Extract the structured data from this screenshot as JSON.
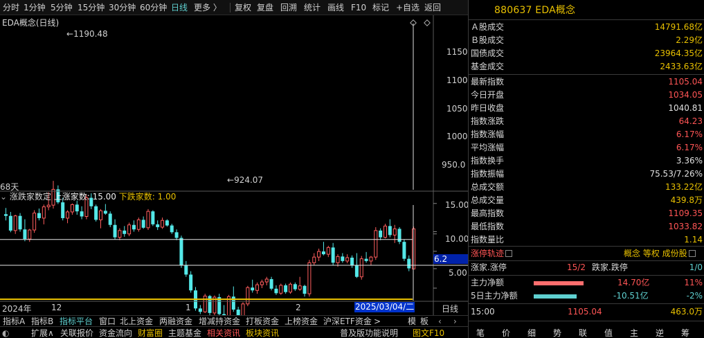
{
  "toolbar": {
    "items": [
      "分时",
      "1分钟",
      "5分钟",
      "15分钟",
      "30分钟",
      "60分钟",
      "日线",
      "更多 〉",
      "复权",
      "复盘",
      "回溯",
      "统计",
      "画线",
      "F10",
      "标记",
      "+自选",
      "返回"
    ],
    "active": "日线"
  },
  "chart": {
    "title": "EDA概念(日线)",
    "days_label": "68天",
    "high_marker": "1190.48",
    "low_marker": "924.07",
    "y_ticks": [
      "1150",
      "1100",
      "1050",
      "1000",
      "950.0"
    ],
    "indicator": {
      "name": "涨跌家数定",
      "up_label": "上涨家数: 15.00",
      "down_label": "下跌家数: 1.00",
      "y_ticks": [
        "15.00",
        "10.00",
        "5.00"
      ],
      "current_tag": "6.2"
    },
    "x_labels": [
      "2024年",
      "12",
      "1",
      "2"
    ],
    "cursor_date": "2025/03/04/二",
    "period_btn": "日线"
  },
  "chart_data": {
    "type": "candlestick",
    "ylim": [
      910,
      1200
    ],
    "candles": [
      [
        1131,
        1142,
        1120,
        1128
      ],
      [
        1128,
        1135,
        1099,
        1102
      ],
      [
        1102,
        1130,
        1096,
        1128
      ],
      [
        1128,
        1133,
        1100,
        1104
      ],
      [
        1104,
        1122,
        1083,
        1087
      ],
      [
        1087,
        1105,
        1082,
        1103
      ],
      [
        1103,
        1138,
        1098,
        1133
      ],
      [
        1133,
        1141,
        1120,
        1124
      ],
      [
        1124,
        1148,
        1113,
        1144
      ],
      [
        1144,
        1170,
        1138,
        1147
      ],
      [
        1147,
        1190,
        1141,
        1175
      ],
      [
        1175,
        1182,
        1149,
        1152
      ],
      [
        1152,
        1160,
        1120,
        1124
      ],
      [
        1124,
        1138,
        1115,
        1135
      ],
      [
        1135,
        1150,
        1130,
        1148
      ],
      [
        1148,
        1155,
        1130,
        1136
      ],
      [
        1136,
        1145,
        1122,
        1127
      ],
      [
        1127,
        1165,
        1122,
        1160
      ],
      [
        1160,
        1168,
        1140,
        1145
      ],
      [
        1145,
        1148,
        1118,
        1121
      ],
      [
        1121,
        1140,
        1106,
        1137
      ],
      [
        1137,
        1149,
        1130,
        1132
      ],
      [
        1132,
        1136,
        1108,
        1112
      ],
      [
        1112,
        1122,
        1086,
        1090
      ],
      [
        1090,
        1106,
        1085,
        1102
      ],
      [
        1102,
        1110,
        1091,
        1096
      ],
      [
        1096,
        1116,
        1092,
        1112
      ],
      [
        1112,
        1120,
        1100,
        1104
      ],
      [
        1104,
        1125,
        1100,
        1121
      ],
      [
        1121,
        1127,
        1105,
        1107
      ],
      [
        1107,
        1140,
        1103,
        1136
      ],
      [
        1136,
        1138,
        1110,
        1113
      ],
      [
        1113,
        1120,
        1103,
        1108
      ],
      [
        1108,
        1125,
        1105,
        1120
      ],
      [
        1120,
        1122,
        1109,
        1111
      ],
      [
        1111,
        1114,
        1096,
        1099
      ],
      [
        1099,
        1104,
        1085,
        1089
      ],
      [
        1089,
        1093,
        1036,
        1040
      ],
      [
        1040,
        1048,
        1020,
        1024
      ],
      [
        1024,
        1030,
        992,
        996
      ],
      [
        996,
        1002,
        960,
        964
      ],
      [
        964,
        970,
        954,
        958
      ],
      [
        958,
        990,
        956,
        986
      ],
      [
        986,
        988,
        952,
        956
      ],
      [
        956,
        987,
        952,
        984
      ],
      [
        984,
        990,
        948,
        954
      ],
      [
        954,
        970,
        935,
        944
      ],
      [
        944,
        988,
        940,
        985
      ],
      [
        985,
        1003,
        958,
        962
      ],
      [
        962,
        967,
        927,
        937
      ],
      [
        937,
        975,
        932,
        972
      ],
      [
        972,
        1004,
        968,
        1001
      ],
      [
        1001,
        1015,
        992,
        996
      ],
      [
        996,
        1010,
        990,
        1006
      ],
      [
        1006,
        1015,
        1000,
        1011
      ],
      [
        1011,
        1020,
        1005,
        1016
      ],
      [
        1016,
        1020,
        996,
        999
      ],
      [
        999,
        1005,
        988,
        991
      ],
      [
        991,
        1008,
        988,
        1005
      ],
      [
        1005,
        1008,
        990,
        993
      ],
      [
        993,
        1010,
        990,
        1007
      ],
      [
        1007,
        1010,
        995,
        998
      ],
      [
        998,
        1020,
        995,
        1004
      ],
      [
        1004,
        1006,
        985,
        990
      ],
      [
        990,
        1050,
        985,
        1045
      ],
      [
        1045,
        1062,
        1040,
        1055
      ],
      [
        1055,
        1070,
        1048,
        1065
      ],
      [
        1065,
        1082,
        1058,
        1060
      ],
      [
        1060,
        1075,
        1055,
        1072
      ],
      [
        1072,
        1080,
        1040,
        1045
      ],
      [
        1045,
        1060,
        1038,
        1056
      ],
      [
        1056,
        1062,
        1045,
        1048
      ],
      [
        1048,
        1060,
        1044,
        1054
      ],
      [
        1054,
        1058,
        1036,
        1040
      ],
      [
        1040,
        1062,
        1018,
        1020
      ],
      [
        1020,
        1057,
        1015,
        1052
      ],
      [
        1052,
        1064,
        1045,
        1048
      ],
      [
        1048,
        1057,
        1040,
        1055
      ],
      [
        1055,
        1108,
        1050,
        1102
      ],
      [
        1102,
        1106,
        1085,
        1090
      ],
      [
        1090,
        1114,
        1088,
        1110
      ],
      [
        1110,
        1122,
        1090,
        1094
      ],
      [
        1094,
        1112,
        1080,
        1105
      ],
      [
        1105,
        1108,
        1078,
        1082
      ],
      [
        1082,
        1086,
        1048,
        1052
      ],
      [
        1052,
        1058,
        1030,
        1035
      ],
      [
        1034,
        1109,
        1034,
        1105
      ]
    ],
    "indicator_series": {
      "name": "涨跌家数定",
      "up": 15.0,
      "down": 1.0,
      "ylim": [
        0,
        17.5
      ]
    }
  },
  "right_panel": {
    "title": "880637 EDA概念",
    "block1": [
      {
        "k": "Ａ股成交",
        "v": "14791.68亿"
      },
      {
        "k": "Ｂ股成交",
        "v": "2.29亿"
      },
      {
        "k": "国债成交",
        "v": "23964.35亿"
      },
      {
        "k": "基金成交",
        "v": "2433.63亿"
      }
    ],
    "block2": [
      {
        "k": "最新指数",
        "v": "1105.04",
        "c": "red"
      },
      {
        "k": "今日开盘",
        "v": "1034.05",
        "c": "red"
      },
      {
        "k": "昨日收盘",
        "v": "1040.81",
        "c": "white"
      },
      {
        "k": "指数涨跌",
        "v": "64.23",
        "c": "red"
      },
      {
        "k": "指数涨幅",
        "v": "6.17%",
        "c": "red"
      },
      {
        "k": "平均涨幅",
        "v": "6.17%",
        "c": "red"
      },
      {
        "k": "指数换手",
        "v": "3.36%",
        "c": "white"
      },
      {
        "k": "指数振幅",
        "v": "75.53/7.26%",
        "c": "white"
      },
      {
        "k": "总成交额",
        "v": "133.22亿",
        "c": "gold"
      },
      {
        "k": "总成交量",
        "v": "439.8万",
        "c": "gold"
      },
      {
        "k": "最高指数",
        "v": "1109.35",
        "c": "red"
      },
      {
        "k": "最低指数",
        "v": "1033.82",
        "c": "red"
      },
      {
        "k": "指数量比",
        "v": "1.14",
        "c": "gold"
      }
    ],
    "zt_label": "涨停轨迹",
    "zt_links": "概念 等权 成份股",
    "zt_row": {
      "k1": "涨家.涨停",
      "v1": "15/2",
      "k2": "跌家.跌停",
      "v2": "1/0"
    },
    "flow": [
      {
        "k": "主力净额",
        "v": "14.70亿",
        "p": "11%",
        "c": "red",
        "bar": 0.55
      },
      {
        "k": "5日主力净额",
        "v": "-10.51亿",
        "p": "-2%",
        "c": "cyan",
        "bar": 0.48
      }
    ],
    "last": {
      "time": "15:00",
      "price": "1105.04",
      "vol": "463.0万"
    },
    "bottom_btns": [
      "笔",
      "价",
      "细",
      "势",
      "联",
      "值",
      "主",
      "逆",
      "筹"
    ]
  },
  "tabs_row1": [
    "指标A",
    "指标B",
    "指标平台",
    "窗口",
    "北上资金",
    "两融资金",
    "增减持资金",
    "打板资金",
    "上榜资金",
    "沪深ETF资金",
    ">",
    "模",
    "板"
  ],
  "tabs_row1_active": "指标平台",
  "tabs_row2": [
    "扩展∧",
    "关联报价",
    "资金流向",
    "财富圈",
    "主题基金",
    "相关资讯",
    "板块资讯",
    "普及版功能说明",
    "图文F10"
  ],
  "colors": {
    "up": "#ff5e5e",
    "down": "#54e8e8",
    "gold": "#e8c000",
    "panel_bg": "#000000"
  }
}
